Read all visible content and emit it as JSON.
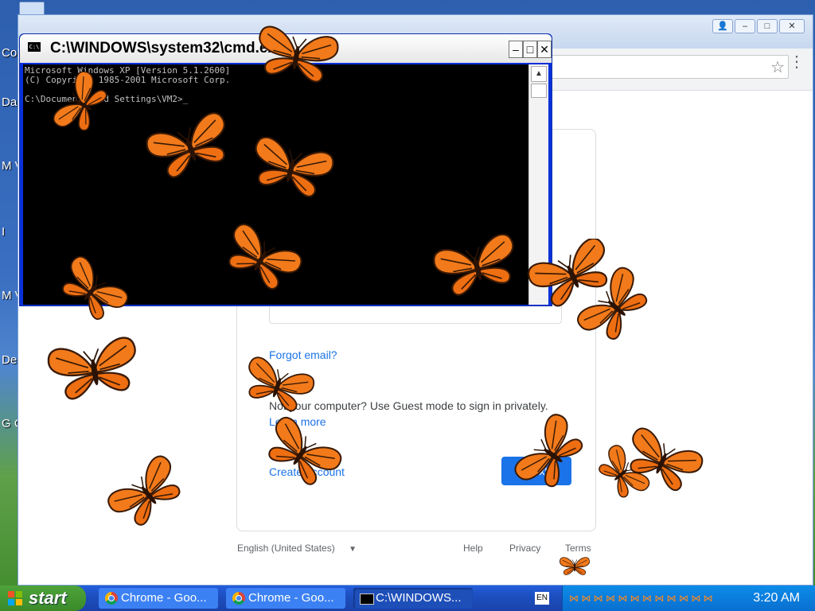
{
  "desktop": {
    "icon_labels": [
      "Co",
      "Da",
      "M\nVi",
      "I",
      "M\nVi",
      "De",
      "G\nC"
    ]
  },
  "chrome": {
    "window_buttons": {
      "user": "👤",
      "minimize": "–",
      "maximize": "□",
      "close": "✕"
    },
    "card": {
      "forgot_email": "Forgot email?",
      "guest_text": "Not your computer? Use Guest mode to sign in privately.",
      "learn_more": "Learn more",
      "create_account": "Create account",
      "next_button": "Next"
    },
    "footer": {
      "language": "English (United States)",
      "help": "Help",
      "privacy": "Privacy",
      "terms": "Terms"
    }
  },
  "cmd": {
    "title": "C:\\WINDOWS\\system32\\cmd.exe",
    "buttons": {
      "minimize": "–",
      "maximize": "□",
      "close": "✕"
    },
    "console_text": "Microsoft Windows XP [Version 5.1.2600]\n(C) Copyright 1985-2001 Microsoft Corp.\n\nC:\\Documents and Settings\\VM2>_"
  },
  "taskbar": {
    "start_label": "start",
    "tasks": [
      {
        "label": "Chrome - Goo..."
      },
      {
        "label": "Chrome - Goo..."
      },
      {
        "label": "C:\\WINDOWS..."
      }
    ],
    "lang": "EN",
    "clock": "3:20 AM"
  },
  "colors": {
    "accent": "#1a73e8",
    "butterfly_orange": "#f27a1a",
    "taskbar_blue": "#245edb",
    "start_green": "#3a8a2a"
  }
}
